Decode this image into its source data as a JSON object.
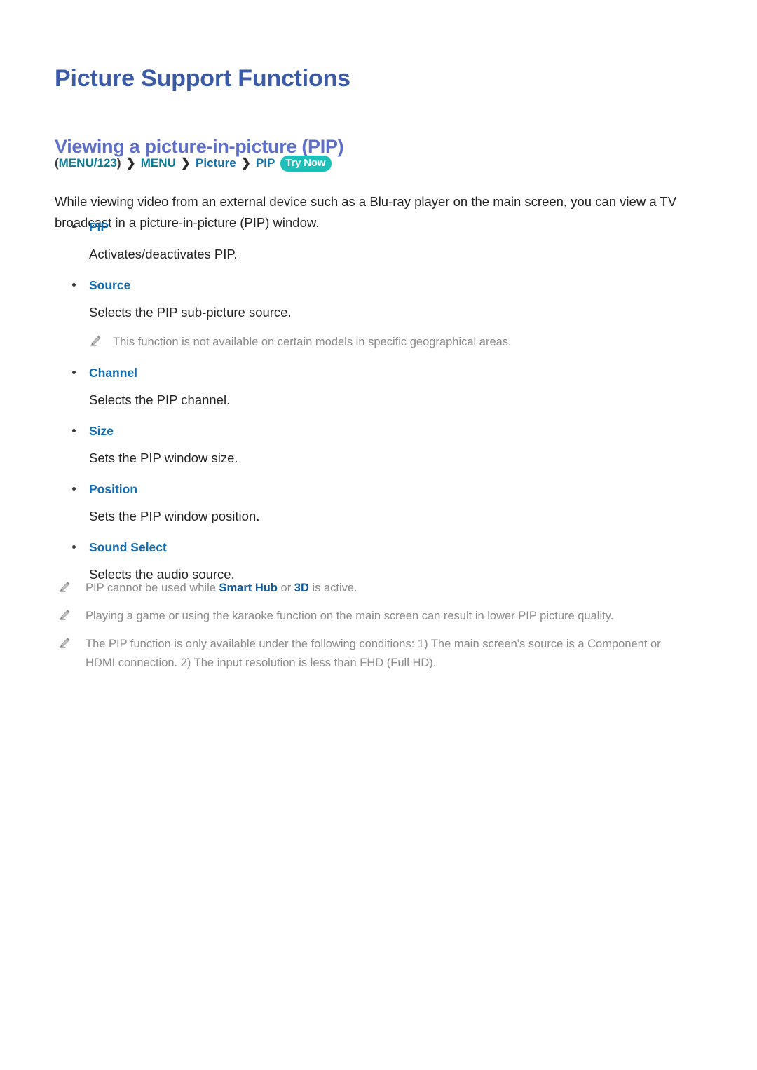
{
  "document": {
    "page_title": "Picture Support Functions",
    "section_title": "Viewing a picture-in-picture (PIP)"
  },
  "breadcrumb": {
    "open_paren": "(",
    "item1": "MENU/123",
    "close_paren": ")",
    "separator": "❯",
    "item2": "MENU",
    "item3": "Picture",
    "item4": "PIP",
    "badge": "Try Now"
  },
  "intro": {
    "text": "While viewing video from an external device such as a Blu-ray player on the main screen, you can view a TV broadcast in a picture-in-picture (PIP) window."
  },
  "options": [
    {
      "label": "PIP",
      "description": "Activates/deactivates PIP."
    },
    {
      "label": "Source",
      "description": "Selects the PIP sub-picture source.",
      "note": "This function is not available on certain models in specific geographical areas."
    },
    {
      "label": "Channel",
      "description": "Selects the PIP channel."
    },
    {
      "label": "Size",
      "description": "Sets the PIP window size."
    },
    {
      "label": "Position",
      "description": "Sets the PIP window position."
    },
    {
      "label": "Sound Select",
      "description": "Selects the audio source."
    }
  ],
  "bottom_notes": [
    {
      "part1": "PIP cannot be used while ",
      "highlight1": "Smart Hub",
      "part2": " or ",
      "highlight2": "3D",
      "part3": " is active."
    },
    {
      "part1": "Playing a game or using the karaoke function on the main screen can result in lower PIP picture quality."
    },
    {
      "part1": "The PIP function is only available under the following conditions: 1) The main screen's source is a Component or HDMI connection. 2) The input resolution is less than FHD (Full HD)."
    }
  ],
  "colors": {
    "page_title": "#3c5ba6",
    "section_title": "#5d6fc9",
    "breadcrumb_item": "#0b7b96",
    "badge_bg": "#1dbfb8",
    "option_label": "#0f6cb5",
    "note_text": "#8a8a8a",
    "note_highlight": "#0f5a9e"
  }
}
